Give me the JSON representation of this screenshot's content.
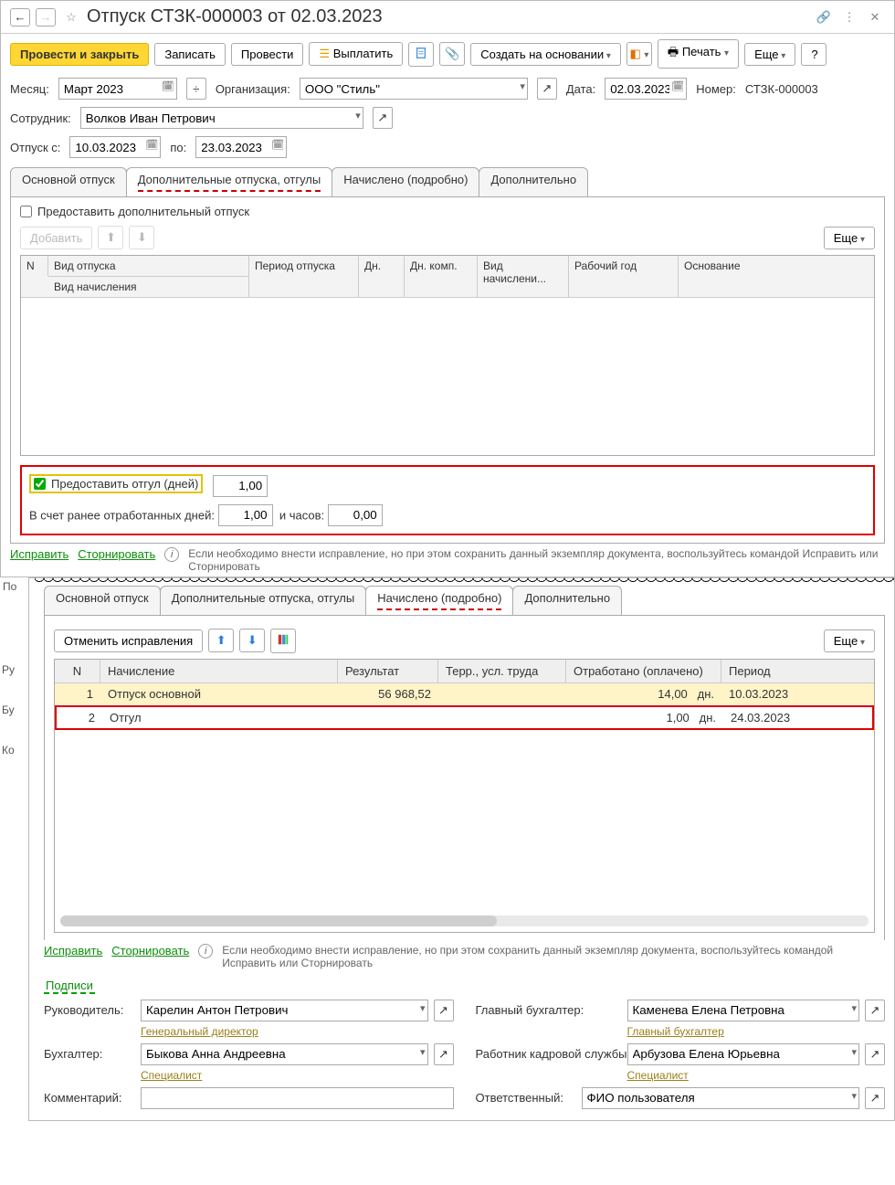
{
  "title": "Отпуск СТЗК-000003 от 02.03.2023",
  "toolbar": {
    "post_close": "Провести и закрыть",
    "save": "Записать",
    "post": "Провести",
    "pay": "Выплатить",
    "create_based": "Создать на основании",
    "print": "Печать",
    "more": "Еще",
    "help": "?"
  },
  "fields": {
    "month_label": "Месяц:",
    "month_value": "Март 2023",
    "org_label": "Организация:",
    "org_value": "ООО \"Стиль\"",
    "date_label": "Дата:",
    "date_value": "02.03.2023",
    "number_label": "Номер:",
    "number_value": "СТЗК-000003",
    "employee_label": "Сотрудник:",
    "employee_value": "Волков Иван Петрович",
    "vac_from_label": "Отпуск с:",
    "vac_from_value": "10.03.2023",
    "vac_to_label": "по:",
    "vac_to_value": "23.03.2023"
  },
  "tabs1": {
    "t1": "Основной отпуск",
    "t2": "Дополнительные отпуска, отгулы",
    "t3": "Начислено (подробно)",
    "t4": "Дополнительно"
  },
  "addvac": {
    "checkbox_label": "Предоставить дополнительный отпуск",
    "add_btn": "Добавить",
    "more_btn": "Еще"
  },
  "grid1": {
    "c_n": "N",
    "c_type": "Вид отпуска",
    "c_type2": "Вид начисления",
    "c_period": "Период отпуска",
    "c_days": "Дн.",
    "c_daysк": "Дн. комп.",
    "c_kind": "Вид начислени...",
    "c_year": "Рабочий год",
    "c_basis": "Основание"
  },
  "timeoff": {
    "give_label": "Предоставить отгул (дней)",
    "give_value": "1,00",
    "prefix_label": "В счет ранее отработанных дней:",
    "days_value": "1,00",
    "hours_label": "и часов:",
    "hours_value": "0,00"
  },
  "correction": {
    "fix": "Исправить",
    "reverse": "Сторнировать",
    "note": "Если необходимо внести исправление, но при этом сохранить данный экземпляр документа, воспользуйтесь командой Исправить или Сторнировать"
  },
  "left_fragments": {
    "ru": "Ру",
    "bu": "Бу",
    "ko": "Ко",
    "po": "По"
  },
  "tabs2": {
    "t1": "Основной отпуск",
    "t2": "Дополнительные отпуска, отгулы",
    "t3": "Начислено (подробно)",
    "t4": "Дополнительно"
  },
  "panel2": {
    "cancel": "Отменить исправления",
    "more": "Еще"
  },
  "grid2": {
    "h_n": "N",
    "h_acc": "Начисление",
    "h_res": "Результат",
    "h_terr": "Терр., усл. труда",
    "h_worked": "Отработано (оплачено)",
    "h_period": "Период",
    "rows": [
      {
        "n": "1",
        "acc": "Отпуск основной",
        "res": "56 968,52",
        "worked": "14,00",
        "unit": "дн.",
        "period": "10.03.2023"
      },
      {
        "n": "2",
        "acc": "Отгул",
        "res": "",
        "worked": "1,00",
        "unit": "дн.",
        "period": "24.03.2023"
      }
    ]
  },
  "sign": {
    "title": "Подписи",
    "head_label": "Руководитель:",
    "head_value": "Карелин Антон Петрович",
    "head_pos": "Генеральный директор",
    "chief_acc_label": "Главный бухгалтер:",
    "chief_acc_value": "Каменева Елена Петровна",
    "chief_acc_pos": "Главный бухгалтер",
    "acc_label": "Бухгалтер:",
    "acc_value": "Быкова Анна Андреевна",
    "acc_pos": "Специалист",
    "hr_label": "Работник кадровой службы:",
    "hr_value": "Арбузова Елена Юрьевна",
    "hr_pos": "Специалист",
    "comment_label": "Комментарий:",
    "resp_label": "Ответственный:",
    "resp_value": "ФИО пользователя"
  }
}
